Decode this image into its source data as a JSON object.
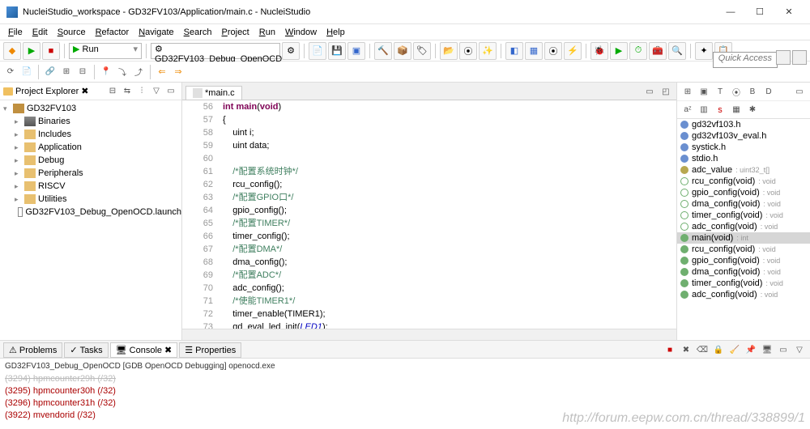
{
  "window": {
    "title": "NucleiStudio_workspace - GD32FV103/Application/main.c - NucleiStudio"
  },
  "menu": [
    "File",
    "Edit",
    "Source",
    "Refactor",
    "Navigate",
    "Search",
    "Project",
    "Run",
    "Window",
    "Help"
  ],
  "toolbar": {
    "run_mode": "Run",
    "debug_config": "GD32FV103_Debug_OpenOCD"
  },
  "quick_access": "Quick Access",
  "project_explorer": {
    "title": "Project Explorer",
    "root": "GD32FV103",
    "nodes": [
      {
        "label": "Binaries",
        "type": "bin"
      },
      {
        "label": "Includes",
        "type": "folder"
      },
      {
        "label": "Application",
        "type": "folder"
      },
      {
        "label": "Debug",
        "type": "folder"
      },
      {
        "label": "Peripherals",
        "type": "folder"
      },
      {
        "label": "RISCV",
        "type": "folder"
      },
      {
        "label": "Utilities",
        "type": "folder"
      },
      {
        "label": "GD32FV103_Debug_OpenOCD.launch",
        "type": "launch"
      }
    ]
  },
  "editor": {
    "tab": "*main.c",
    "lines": [
      {
        "n": 56,
        "html": "<span class='kw'>int</span> <span class='kw'>main</span>(<span class='kw'>void</span>)"
      },
      {
        "n": 57,
        "html": "{"
      },
      {
        "n": 58,
        "html": "    uint i;"
      },
      {
        "n": 59,
        "html": "    uint data;"
      },
      {
        "n": 60,
        "html": ""
      },
      {
        "n": 61,
        "html": "    <span class='cm'>/*配置系统时钟*/</span>"
      },
      {
        "n": 62,
        "html": "    rcu_config();"
      },
      {
        "n": 63,
        "html": "    <span class='cm'>/*配置GPIO口*/</span>"
      },
      {
        "n": 64,
        "html": "    gpio_config();"
      },
      {
        "n": 65,
        "html": "    <span class='cm'>/*配置TIMER*/</span>"
      },
      {
        "n": 66,
        "html": "    timer_config();"
      },
      {
        "n": 67,
        "html": "    <span class='cm'>/*配置DMA*/</span>"
      },
      {
        "n": 68,
        "html": "    dma_config();"
      },
      {
        "n": 69,
        "html": "    <span class='cm'>/*配置ADC*/</span>"
      },
      {
        "n": 70,
        "html": "    adc_config();"
      },
      {
        "n": 71,
        "html": "    <span class='cm'>/*使能TIMER1*/</span>"
      },
      {
        "n": 72,
        "html": "    timer_enable(TIMER1);"
      },
      {
        "n": 73,
        "html": "    gd_eval_led_init(<span class='it'>LED1</span>);"
      }
    ]
  },
  "outline": [
    {
      "icon": "h",
      "label": "gd32vf103.h"
    },
    {
      "icon": "h",
      "label": "gd32vf103v_eval.h"
    },
    {
      "icon": "h",
      "label": "systick.h"
    },
    {
      "icon": "h",
      "label": "stdio.h"
    },
    {
      "icon": "y",
      "label": "adc_value",
      "type": ": uint32_t[]"
    },
    {
      "icon": "g2",
      "label": "rcu_config(void)",
      "type": ": void"
    },
    {
      "icon": "g2",
      "label": "gpio_config(void)",
      "type": ": void"
    },
    {
      "icon": "g2",
      "label": "dma_config(void)",
      "type": ": void"
    },
    {
      "icon": "g2",
      "label": "timer_config(void)",
      "type": ": void"
    },
    {
      "icon": "g2",
      "label": "adc_config(void)",
      "type": ": void"
    },
    {
      "icon": "g",
      "label": "main(void)",
      "type": ": int",
      "sel": true
    },
    {
      "icon": "g",
      "label": "rcu_config(void)",
      "type": ": void"
    },
    {
      "icon": "g",
      "label": "gpio_config(void)",
      "type": ": void"
    },
    {
      "icon": "g",
      "label": "dma_config(void)",
      "type": ": void"
    },
    {
      "icon": "g",
      "label": "timer_config(void)",
      "type": ": void"
    },
    {
      "icon": "g",
      "label": "adc_config(void)",
      "type": ": void"
    }
  ],
  "bottom": {
    "tabs": [
      "Problems",
      "Tasks",
      "Console",
      "Properties"
    ],
    "active": 2,
    "subtitle": "GD32FV103_Debug_OpenOCD [GDB OpenOCD Debugging] openocd.exe",
    "lines": [
      "(3294) hpmcounter29h (/32)",
      "(3295) hpmcounter30h (/32)",
      "(3296) hpmcounter31h (/32)",
      "(3922) mvendorid (/32)"
    ]
  },
  "watermark": "http://forum.eepw.com.cn/thread/338899/1"
}
